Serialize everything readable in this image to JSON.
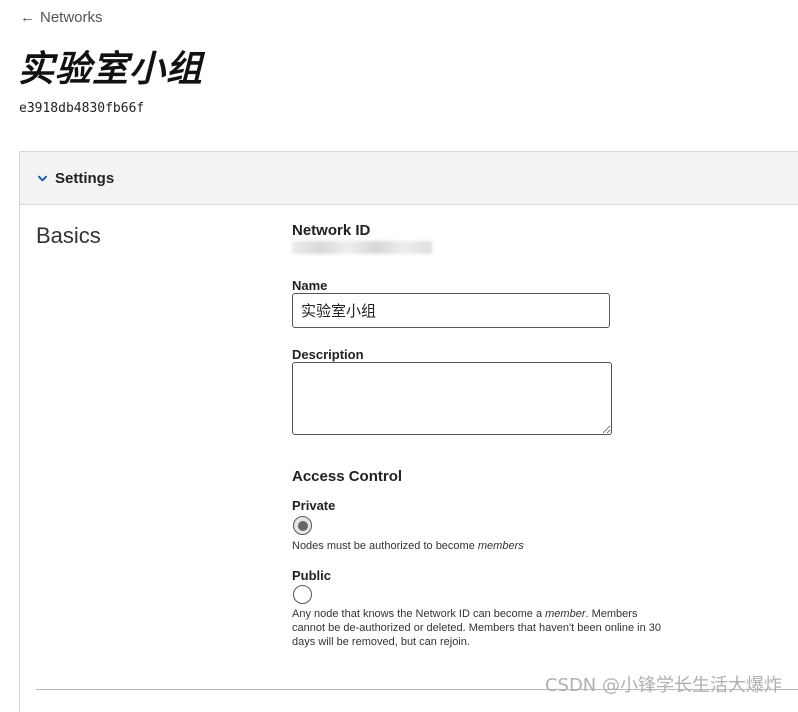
{
  "back_link": {
    "label": "Networks",
    "icon": "arrow-left-icon"
  },
  "page": {
    "title": "实验室小组",
    "network_hash": "e3918db4830fb66f"
  },
  "settings_panel": {
    "toggle_label": "Settings",
    "toggle_icon": "chevron-down-icon",
    "accent_color": "#1a5ea8"
  },
  "basics": {
    "title": "Basics",
    "network_id_label": "Network ID",
    "name_label": "Name",
    "name_value": "实验室小组",
    "description_label": "Description",
    "description_value": ""
  },
  "access_control": {
    "title": "Access Control",
    "private": {
      "label": "Private",
      "selected": true,
      "help_prefix": "Nodes must be authorized to become ",
      "help_em": "members"
    },
    "public": {
      "label": "Public",
      "selected": false,
      "help_prefix": "Any node that knows the Network ID can become a ",
      "help_em": "member",
      "help_suffix": ". Members cannot be de-authorized or deleted. Members that haven't been online in 30 days will be removed, but can rejoin."
    }
  },
  "watermark": "CSDN @小锋学长生活大爆炸"
}
